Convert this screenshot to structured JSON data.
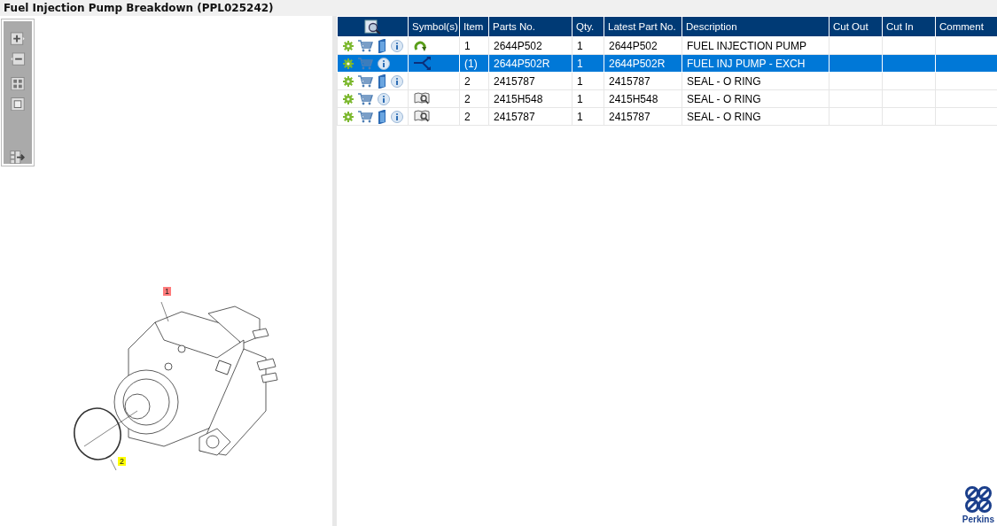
{
  "window": {
    "title": "Fuel Injection Pump Breakdown (PPL025242)"
  },
  "diagram": {
    "callouts": [
      {
        "label": "1",
        "color": "#ff7b7b"
      },
      {
        "label": "2",
        "color": "#ffff00"
      }
    ]
  },
  "table": {
    "columns": [
      "Symbol(s)",
      "Item",
      "Parts No.",
      "Qty.",
      "Latest Part No.",
      "Description",
      "Cut Out",
      "Cut In",
      "Comment"
    ],
    "rows": [
      {
        "selected": false,
        "manual": true,
        "symbol": {
          "kind": "replacement"
        },
        "item": "1",
        "parts_no": "2644P502",
        "qty": "1",
        "latest_part_no": "2644P502",
        "description": "FUEL INJECTION PUMP"
      },
      {
        "selected": true,
        "manual": false,
        "symbol": {
          "kind": "exchange"
        },
        "item": "(1)",
        "parts_no": "2644P502R",
        "qty": "1",
        "latest_part_no": "2644P502R",
        "description": "FUEL INJ PUMP - EXCH"
      },
      {
        "selected": false,
        "manual": true,
        "item": "2",
        "parts_no": "2415787",
        "qty": "1",
        "latest_part_no": "2415787",
        "description": "SEAL - O RING"
      },
      {
        "selected": false,
        "manual": false,
        "symbol": {
          "kind": "illustration"
        },
        "item": "2",
        "parts_no": "2415H548",
        "qty": "1",
        "latest_part_no": "2415H548",
        "description": "SEAL - O RING"
      },
      {
        "selected": false,
        "manual": true,
        "symbol": {
          "kind": "illustration"
        },
        "item": "2",
        "parts_no": "2415787",
        "qty": "1",
        "latest_part_no": "2415787",
        "description": "SEAL - O RING"
      }
    ]
  },
  "logo": {
    "text": "Perkins"
  }
}
